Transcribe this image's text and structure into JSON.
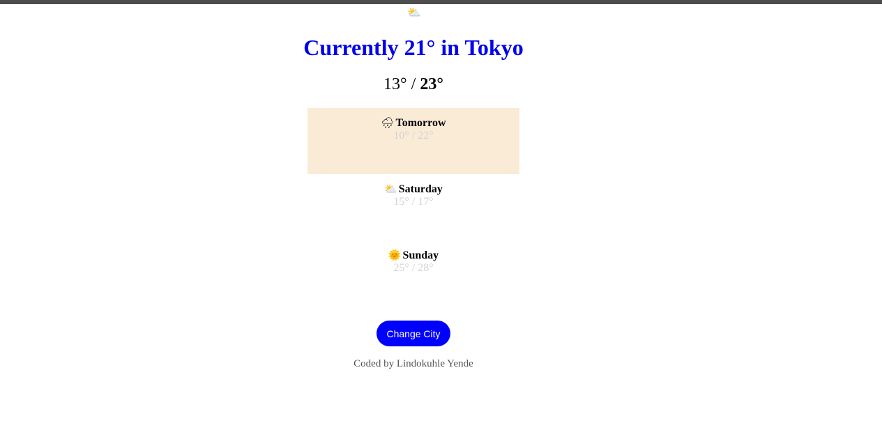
{
  "current": {
    "icon": "partly-cloudy-icon",
    "icon_glyph": "⛅",
    "title": "Currently 21° in Tokyo",
    "low": "13°",
    "separator": " / ",
    "high": "23°"
  },
  "forecast": [
    {
      "day": "Tomorrow",
      "icon": "rain-cloud-icon",
      "icon_glyph": "🌧",
      "temps": "10° / 22°",
      "highlighted": true
    },
    {
      "day": "Saturday",
      "icon": "partly-cloudy-icon",
      "icon_glyph": "⛅",
      "temps": "15° / 17°",
      "highlighted": false
    },
    {
      "day": "Sunday",
      "icon": "sun-icon",
      "icon_glyph": "🌞",
      "temps": "25° / 28°",
      "highlighted": false
    }
  ],
  "actions": {
    "change_city_label": "Change City"
  },
  "footer": {
    "credit": "Coded by Lindokuhle Yende"
  },
  "colors": {
    "title": "#0000ee",
    "button_bg": "#0000ff",
    "highlight_bg": "#faebd7",
    "muted_temps": "#d3d3d3",
    "topbar": "#4d4d4d"
  }
}
